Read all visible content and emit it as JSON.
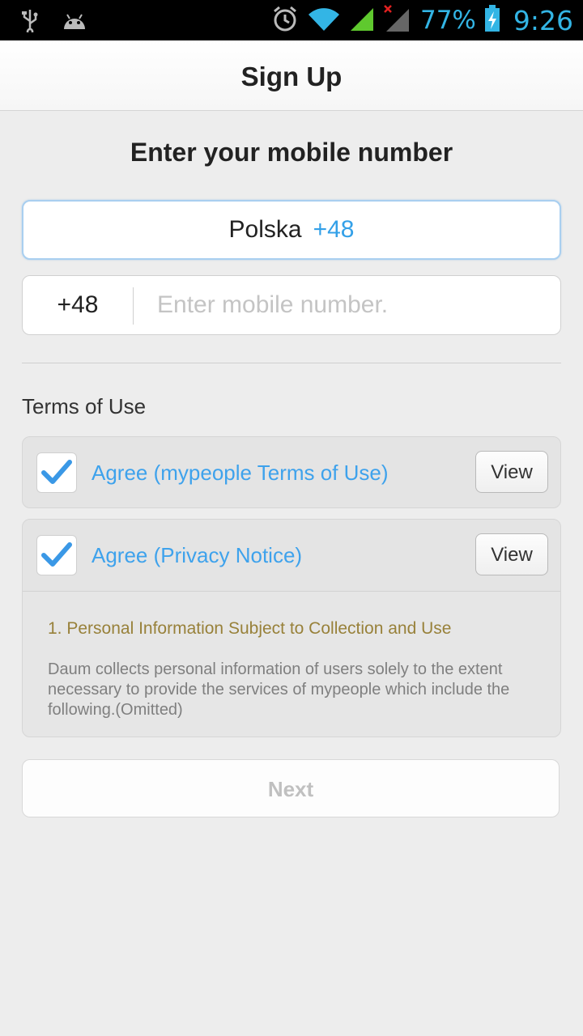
{
  "status_bar": {
    "battery": "77%",
    "time": "9:26",
    "icons": [
      "usb-icon",
      "android-icon",
      "alarm-icon",
      "wifi-icon",
      "signal-icon",
      "no-signal-icon",
      "battery-charging-icon"
    ]
  },
  "header": {
    "title": "Sign Up"
  },
  "main": {
    "heading": "Enter your mobile number",
    "country": {
      "name": "Polska",
      "code": "+48"
    },
    "phone": {
      "prefix": "+48",
      "value": "",
      "placeholder": "Enter mobile number."
    },
    "terms_label": "Terms of Use",
    "terms": [
      {
        "label": "Agree (mypeople Terms of Use)",
        "checked": true,
        "view_label": "View"
      },
      {
        "label": "Agree (Privacy Notice)",
        "checked": true,
        "view_label": "View"
      }
    ],
    "notice": {
      "title": "1. Personal Information Subject to Collection and Use",
      "body": "Daum collects personal information of users solely to the extent necessary to provide the services of mypeople which include the following.(Omitted)"
    },
    "next_label": "Next"
  },
  "colors": {
    "accent": "#33a0e8",
    "status_icon": "#33b5e5",
    "notice_title": "#98813a",
    "background": "#ededed"
  }
}
